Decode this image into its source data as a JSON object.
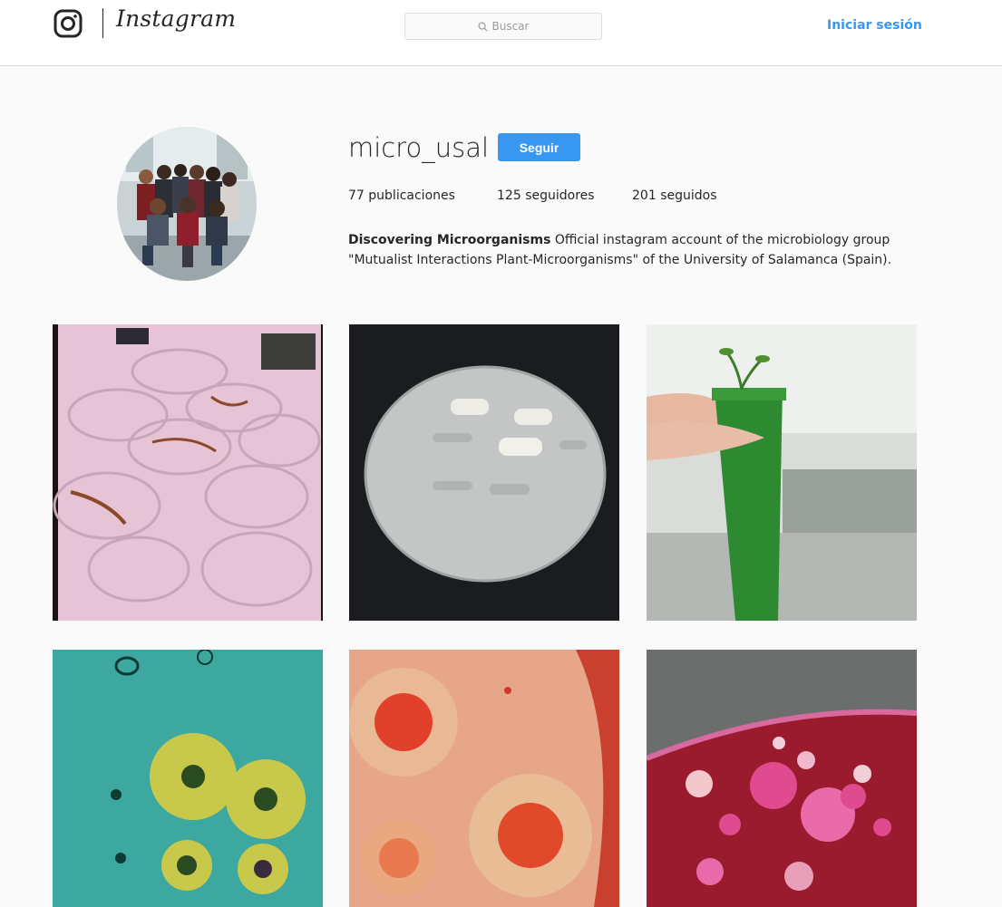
{
  "header": {
    "brand": "Instagram",
    "search_placeholder": "Buscar",
    "login_label": "Iniciar sesión"
  },
  "profile": {
    "username": "micro_usal",
    "follow_label": "Seguir",
    "stats": {
      "posts_count": "77",
      "posts_label": "publicaciones",
      "followers_count": "125",
      "followers_label": "seguidores",
      "following_count": "201",
      "following_label": "seguidos"
    },
    "bio": {
      "title": "Discovering Microorganisms",
      "line1": "Official instagram account of the microbiology group",
      "line2": "\"Mutualist Interactions Plant-Microorganisms\" of the University of Salamanca (Spain)."
    }
  },
  "colors": {
    "accent": "#3897f0",
    "border": "#dbdbdb",
    "background": "#fafafa",
    "text": "#262626"
  },
  "icons": {
    "logo": "instagram-glyph-icon",
    "search": "search-icon"
  }
}
